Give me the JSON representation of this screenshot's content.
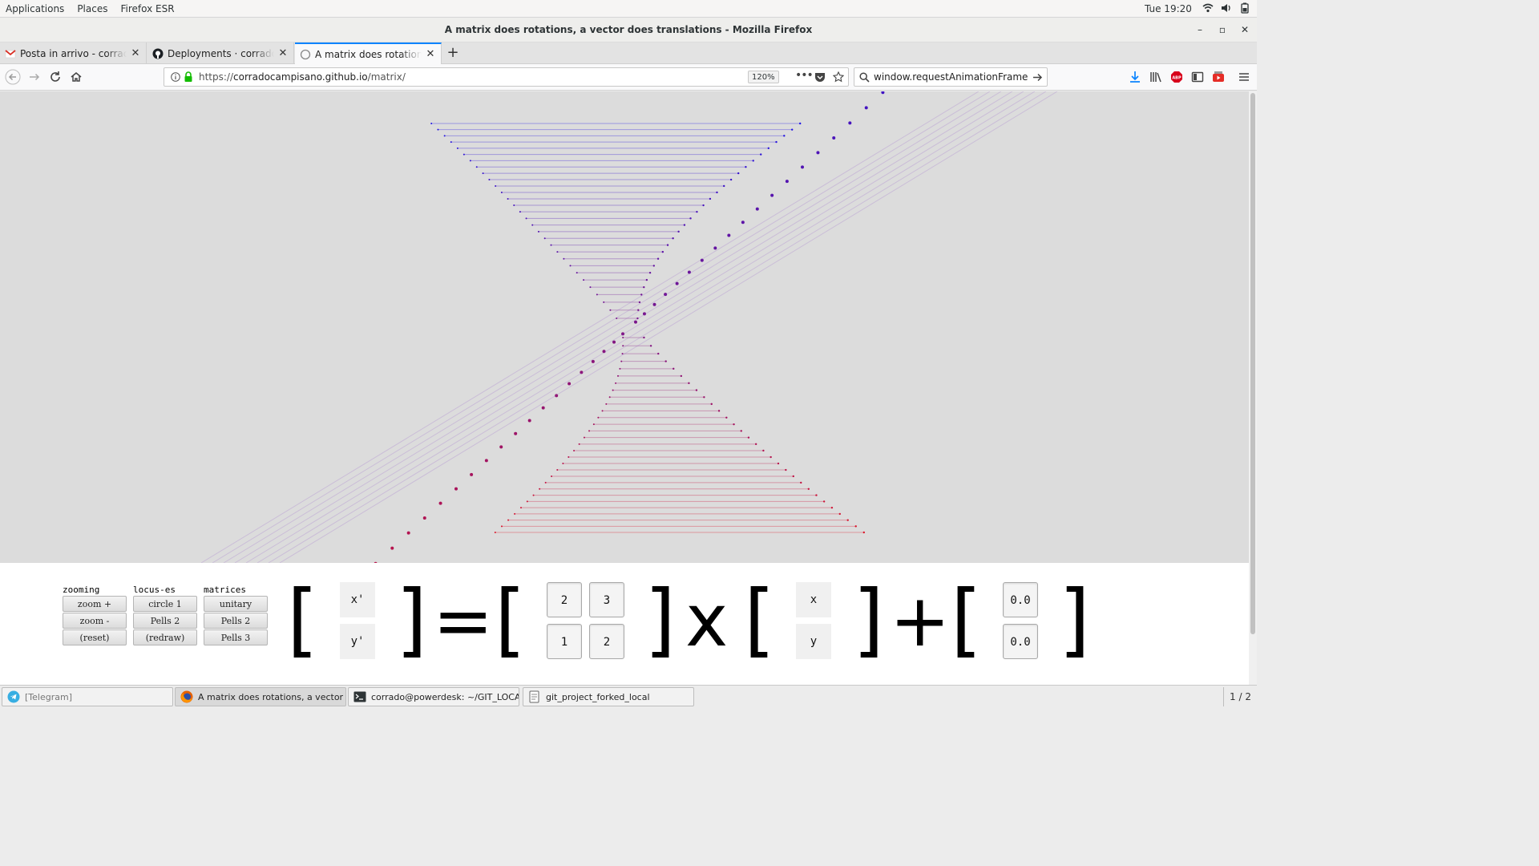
{
  "topbar": {
    "menus": [
      "Applications",
      "Places",
      "Firefox ESR"
    ],
    "clock": "Tue 19:20"
  },
  "window": {
    "title": "A matrix does rotations, a vector does translations - Mozilla Firefox"
  },
  "tabs": [
    {
      "label": "Posta in arrivo - corrado.c",
      "icon": "gmail-icon",
      "active": false
    },
    {
      "label": "Deployments · corradocam",
      "icon": "github-icon",
      "active": false
    },
    {
      "label": "A matrix does rotations, a",
      "icon": "page-icon",
      "active": true
    }
  ],
  "navbar": {
    "url_prefix": "https://",
    "url_host": "corradocampisano.github.io",
    "url_path": "/matrix/",
    "zoom": "120%",
    "search_value": "window.requestAnimationFrame"
  },
  "controls": {
    "zooming": {
      "label": "zooming",
      "buttons": [
        "zoom +",
        "zoom -",
        "(reset)"
      ]
    },
    "locus": {
      "label": "locus-es",
      "buttons": [
        "circle 1",
        "Pells 2",
        "(redraw)"
      ]
    },
    "matrices": {
      "label": "matrices",
      "buttons": [
        "unitary",
        "Pells 2",
        "Pells 3"
      ]
    }
  },
  "equation": {
    "lhs": [
      "x'",
      "y'"
    ],
    "matrix": [
      "2",
      "3",
      "1",
      "2"
    ],
    "vector": [
      "x",
      "y"
    ],
    "translation": [
      "0.0",
      "0.0"
    ],
    "symbols": {
      "open": "[",
      "close": "]",
      "equals": "=",
      "times": "x",
      "plus": "+"
    }
  },
  "taskbar": {
    "tasks": [
      {
        "label": "[Telegram]",
        "icon": "telegram-icon"
      },
      {
        "label": "A matrix does rotations, a vector do...",
        "icon": "firefox-icon"
      },
      {
        "label": "corrado@powerdesk: ~/GIT_LOCAL...",
        "icon": "terminal-icon"
      },
      {
        "label": "git_project_forked_local",
        "icon": "folder-icon"
      }
    ],
    "pager": "1 / 2"
  }
}
